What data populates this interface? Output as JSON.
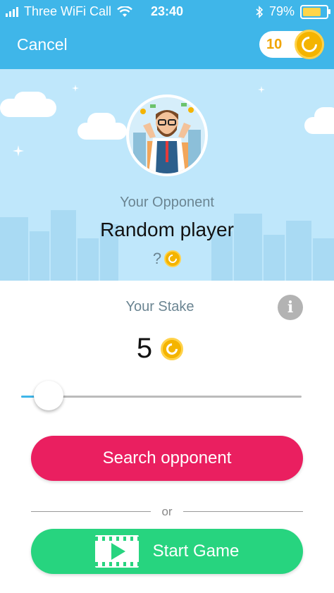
{
  "status_bar": {
    "carrier": "Three WiFi Call",
    "time": "23:40",
    "battery": "79%",
    "battery_level": 0.79
  },
  "header": {
    "cancel_label": "Cancel",
    "coins": "10",
    "bg_color": "#3fb6e9"
  },
  "opponent": {
    "label": "Your Opponent",
    "name": "Random player",
    "stake": "?"
  },
  "stake": {
    "label": "Your Stake",
    "value": "5",
    "slider_fraction": 0.05
  },
  "buttons": {
    "search": "Search opponent",
    "or": "or",
    "start": "Start Game",
    "search_color": "#ea1f60",
    "start_color": "#27d47f"
  },
  "icons": [
    "wifi-icon",
    "bluetooth-icon",
    "battery-icon",
    "coin-icon",
    "avatar-icon",
    "info-icon",
    "video-play-icon"
  ]
}
